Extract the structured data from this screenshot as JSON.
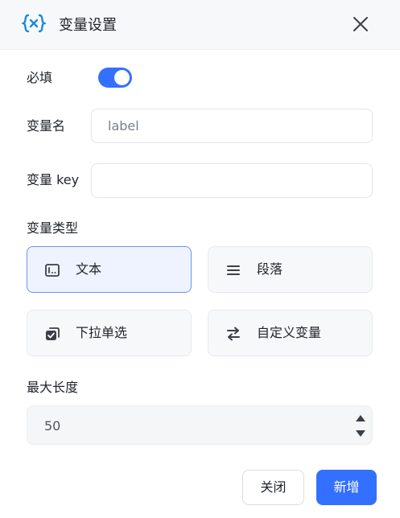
{
  "dialog": {
    "title": "变量设置",
    "header_icon": "variable-icon",
    "close_icon": "close-icon"
  },
  "form": {
    "required_label": "必填",
    "required_on": true,
    "name_label": "变量名",
    "name_placeholder": "label",
    "key_label": "变量 key",
    "key_value": "",
    "type_label": "变量类型",
    "types": [
      {
        "label": "文本",
        "icon": "text-field-icon",
        "selected": true
      },
      {
        "label": "段落",
        "icon": "paragraph-icon",
        "selected": false
      },
      {
        "label": "下拉单选",
        "icon": "dropdown-select-icon",
        "selected": false
      },
      {
        "label": "自定义变量",
        "icon": "swap-icon",
        "selected": false
      }
    ],
    "max_length_label": "最大长度",
    "max_length_value": "50"
  },
  "footer": {
    "close_label": "关闭",
    "add_label": "新增"
  },
  "colors": {
    "accent": "#3370ff",
    "header_bg": "#f7f8fa",
    "selected_card_bg": "#eef3ff",
    "variable_icon": "#1a8ad8"
  }
}
